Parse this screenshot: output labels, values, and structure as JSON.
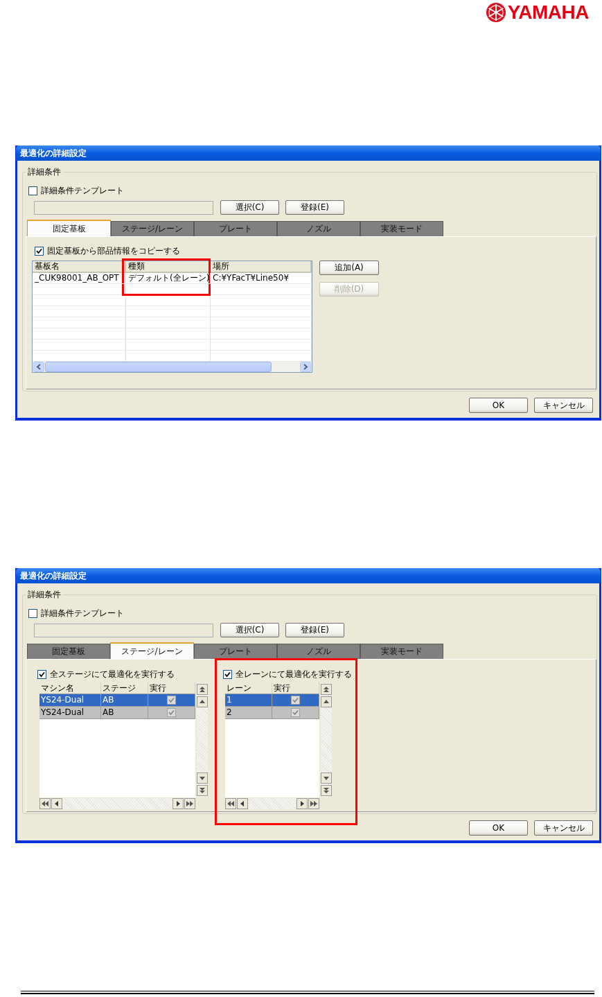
{
  "logo": {
    "text": "YAMAHA"
  },
  "dialogs": [
    {
      "title": "最適化の詳細設定",
      "group_label": "詳細条件",
      "template_checkbox": {
        "label": "詳細条件テンプレート",
        "checked": false
      },
      "buttons": [
        {
          "label": "選択(C)"
        },
        {
          "label": "登録(E)"
        }
      ],
      "tabs": [
        {
          "label": "固定基板",
          "selected": true
        },
        {
          "label": "ステージ/レーン",
          "selected": false
        },
        {
          "label": "プレート",
          "selected": false
        },
        {
          "label": "ノズル",
          "selected": false
        },
        {
          "label": "実装モード",
          "selected": false
        }
      ],
      "panel": {
        "kind": "boards",
        "checkbox": {
          "label": "固定基板から部品情報をコピーする",
          "checked": true
        },
        "table": {
          "columns": [
            {
              "label": "基板名",
              "highlighted": false
            },
            {
              "label": "種類",
              "highlighted": true
            },
            {
              "label": "場所",
              "highlighted": false
            }
          ],
          "rows": [
            [
              "_CUK98001_AB_OPT",
              "デフォルト(全レーン)",
              "C:¥YFacT¥Line50¥"
            ]
          ]
        },
        "side_buttons": [
          {
            "label": "追加(A)",
            "disabled": false
          },
          {
            "label": "削除(D)",
            "disabled": true
          }
        ]
      },
      "footer_buttons": [
        {
          "label": "OK"
        },
        {
          "label": "キャンセル"
        }
      ]
    },
    {
      "title": "最適化の詳細設定",
      "group_label": "詳細条件",
      "template_checkbox": {
        "label": "詳細条件テンプレート",
        "checked": false
      },
      "buttons": [
        {
          "label": "選択(C)"
        },
        {
          "label": "登録(E)"
        }
      ],
      "tabs": [
        {
          "label": "固定基板",
          "selected": false
        },
        {
          "label": "ステージ/レーン",
          "selected": true
        },
        {
          "label": "プレート",
          "selected": false
        },
        {
          "label": "ノズル",
          "selected": false
        },
        {
          "label": "実装モード",
          "selected": false
        }
      ],
      "panel": {
        "kind": "stage_lane",
        "sections": [
          {
            "highlighted": false,
            "checkbox": {
              "label": "全ステージにて最適化を実行する",
              "checked": true
            },
            "columns": [
              "マシン名",
              "ステージ",
              "実行"
            ],
            "rows": [
              {
                "cells": [
                  "YS24-Dual",
                  "AB"
                ],
                "run": true,
                "selected": true
              },
              {
                "cells": [
                  "YS24-Dual",
                  "AB"
                ],
                "run": true,
                "selected": false
              }
            ]
          },
          {
            "highlighted": true,
            "checkbox": {
              "label": "全レーンにて最適化を実行する",
              "checked": true
            },
            "columns": [
              "レーン",
              "実行"
            ],
            "rows": [
              {
                "cells": [
                  "1"
                ],
                "run": true,
                "selected": true
              },
              {
                "cells": [
                  "2"
                ],
                "run": true,
                "selected": false
              }
            ]
          }
        ]
      },
      "footer_buttons": [
        {
          "label": "OK"
        },
        {
          "label": "キャンセル"
        }
      ]
    }
  ]
}
